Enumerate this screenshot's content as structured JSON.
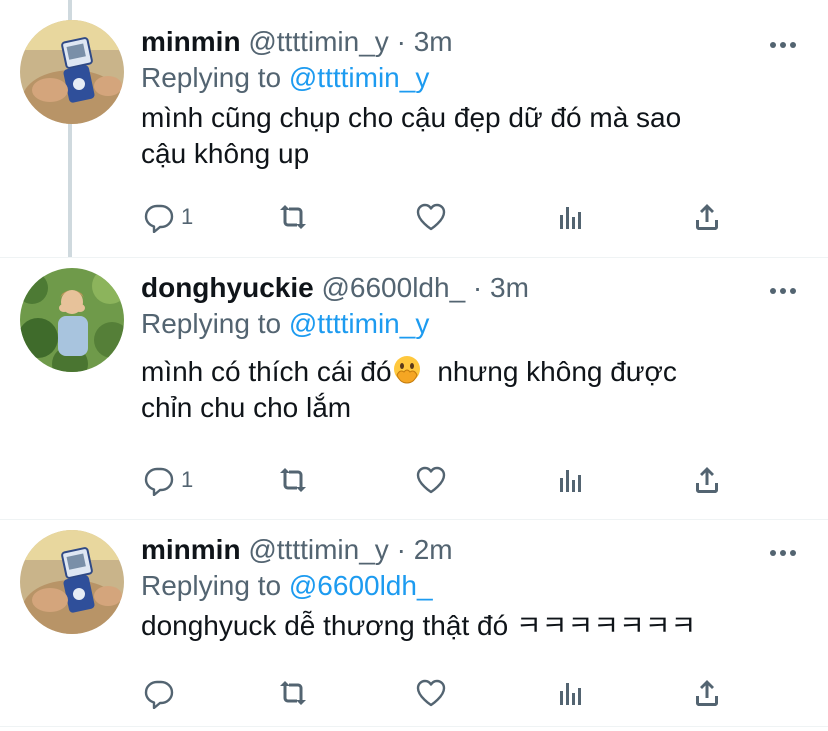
{
  "tweets": [
    {
      "name": "minmin",
      "handle": "@ttttimin_y",
      "time": "3m",
      "separator": "·",
      "replying_prefix": "Replying to",
      "replying_to": "@ttttimin_y",
      "text_lines": [
        "mình cũng chụp cho cậu đẹp dữ đó mà sao",
        "cậu không up"
      ],
      "reply_count": "1",
      "avatar": "avatar-flip-phone"
    },
    {
      "name": "donghyuckie",
      "handle": "@6600ldh_",
      "time": "3m",
      "separator": "·",
      "replying_prefix": "Replying to",
      "replying_to": "@ttttimin_y",
      "text_line1_before": "mình có thích cái đó",
      "emoji": "face-with-hand-over-mouth",
      "text_line1_after": " nhưng không được",
      "text_line2": "chỉn chu cho lắm",
      "reply_count": "1",
      "avatar": "avatar-garden-photo"
    },
    {
      "name": "minmin",
      "handle": "@ttttimin_y",
      "time": "2m",
      "separator": "·",
      "replying_prefix": "Replying to",
      "replying_to": "@6600ldh_",
      "text_lines": [
        "donghyuck dễ thương thật đó ㅋㅋㅋㅋㅋㅋㅋ"
      ],
      "reply_count": "",
      "avatar": "avatar-flip-phone"
    }
  ],
  "colors": {
    "text_primary": "#0f1419",
    "text_secondary": "#536471",
    "mention": "#1d9bf0",
    "thread_line": "#cfd9de"
  },
  "icons": [
    "reply-icon",
    "retweet-icon",
    "like-icon",
    "analytics-icon",
    "share-icon",
    "more-icon"
  ]
}
